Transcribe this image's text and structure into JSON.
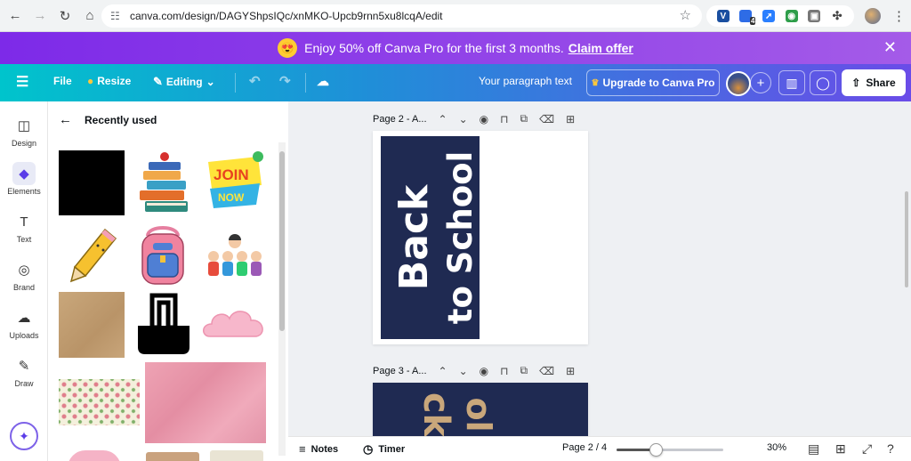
{
  "browser": {
    "url": "canva.com/design/DAGYShpsIQc/xnMKO-Upcb9rnn5xu8lcqA/edit",
    "ext_badge": "4"
  },
  "promo": {
    "text": "Enjoy 50% off Canva Pro for the first 3 months.",
    "claim": "Claim offer"
  },
  "toolbar": {
    "file": "File",
    "resize": "Resize",
    "editing": "Editing",
    "paragraph": "Your paragraph text",
    "upgrade": "Upgrade to Canva Pro",
    "share": "Share"
  },
  "rail": [
    {
      "label": "Design",
      "icon": "design-icon"
    },
    {
      "label": "Elements",
      "icon": "elements-icon"
    },
    {
      "label": "Text",
      "icon": "text-icon"
    },
    {
      "label": "Brand",
      "icon": "brand-icon"
    },
    {
      "label": "Uploads",
      "icon": "uploads-icon"
    },
    {
      "label": "Draw",
      "icon": "draw-icon"
    }
  ],
  "panel": {
    "title": "Recently used"
  },
  "elements": {
    "join_top": "JOIN",
    "join_bottom": "NOW"
  },
  "pages": [
    {
      "label": "Page 2 - A...",
      "line1": "Back",
      "line2": "to School"
    },
    {
      "label": "Page 3 - A...",
      "line1": "ck",
      "line2": "ol"
    }
  ],
  "bottom": {
    "notes": "Notes",
    "timer": "Timer",
    "page_indicator": "Page 2 / 4",
    "zoom": "30%",
    "zoom_fraction": 0.37
  },
  "colors": {
    "brand_purple": "#7d2ae8",
    "navy": "#1f2a52"
  }
}
